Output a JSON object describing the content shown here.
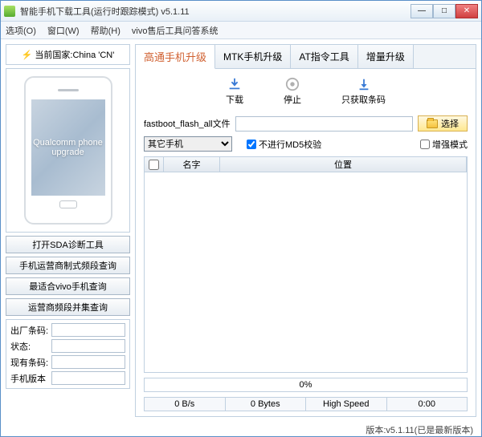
{
  "window": {
    "title": "智能手机下载工具(运行时跟踪模式)  v5.1.11"
  },
  "menu": {
    "options": "选项(O)",
    "window": "窗口(W)",
    "help": "帮助(H)",
    "vivo": "vivo售后工具问答系统"
  },
  "left": {
    "country_label": "当前国家:China 'CN'",
    "phone_text": "Qualcomm phone upgrade",
    "buttons": {
      "sda": "打开SDA诊断工具",
      "carrier": "手机运营商制式频段查询",
      "vivo_query": "最适合vivo手机查询",
      "freq": "运营商频段并集查询"
    },
    "form": {
      "factory_barcode": "出厂条码:",
      "status1": "状态:",
      "current_barcode": "现有条码:",
      "phone_version": "手机版本"
    }
  },
  "tabs": {
    "qualcomm": "高通手机升级",
    "mtk": "MTK手机升级",
    "at": "AT指令工具",
    "incr": "增量升级"
  },
  "actions": {
    "download": "下载",
    "stop": "停止",
    "barcode_only": "只获取条码"
  },
  "fileRow": {
    "label": "fastboot_flash_all文件",
    "value": "",
    "select": "选择"
  },
  "options": {
    "device_type": "其它手机",
    "md5": "不进行MD5校验",
    "enhanced": "增强模式"
  },
  "table": {
    "name": "名字",
    "location": "位置"
  },
  "progress": {
    "text": "0%"
  },
  "status": {
    "speed": "0 B/s",
    "bytes": "0 Bytes",
    "mode": "High Speed",
    "time": "0:00"
  },
  "footer": {
    "version": "版本:v5.1.11(已是最新版本)"
  }
}
